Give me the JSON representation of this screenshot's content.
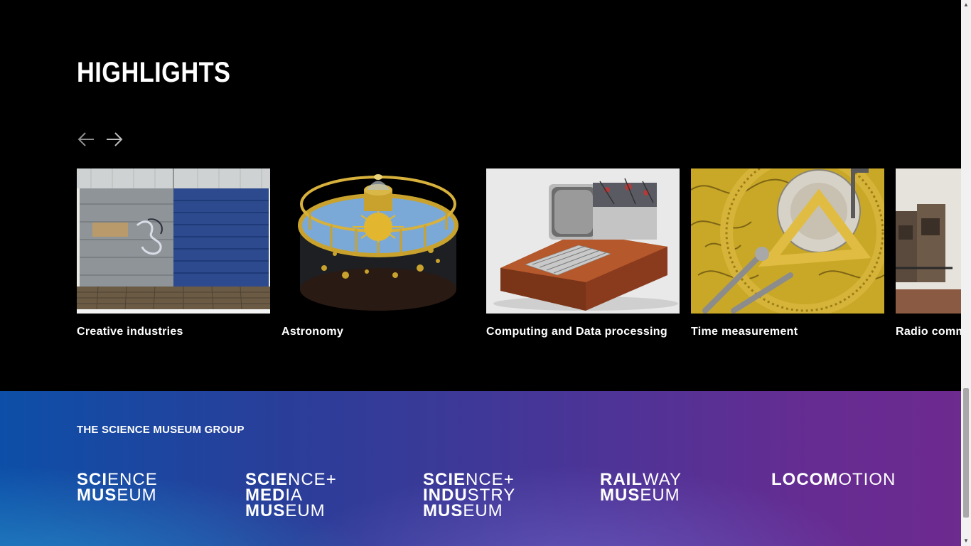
{
  "highlights": {
    "title": "HIGHLIGHTS",
    "prev_icon": "arrow-left-icon",
    "next_icon": "arrow-right-icon",
    "cards": [
      {
        "label": "Creative industries",
        "image": "painted-wooden-crate-photo"
      },
      {
        "label": "Astronomy",
        "image": "brass-orrery-photo"
      },
      {
        "label": "Computing and Data processing",
        "image": "vintage-computer-photo"
      },
      {
        "label": "Time measurement",
        "image": "engraved-clock-gears-photo"
      },
      {
        "label": "Radio comm",
        "image": "radio-equipment-photo"
      }
    ]
  },
  "footer": {
    "group_title": "THE SCIENCE MUSEUM GROUP",
    "logos": [
      {
        "name": "science-museum",
        "lines": [
          [
            "SCI",
            "ENCE"
          ],
          [
            "MUS",
            "EUM"
          ]
        ]
      },
      {
        "name": "science-media-museum",
        "lines": [
          [
            "SCIE",
            "NCE+"
          ],
          [
            "MED",
            "IA"
          ],
          [
            "MUS",
            "EUM"
          ]
        ]
      },
      {
        "name": "science-industry-museum",
        "lines": [
          [
            "SCIE",
            "NCE+"
          ],
          [
            "INDU",
            "STRY"
          ],
          [
            "MUS",
            "EUM"
          ]
        ]
      },
      {
        "name": "railway-museum",
        "lines": [
          [
            "RAIL",
            "WAY"
          ],
          [
            "MUS",
            "EUM"
          ]
        ]
      },
      {
        "name": "locomotion",
        "lines": [
          [
            "LOCOM",
            "OTION"
          ]
        ]
      }
    ],
    "gradient_colors": [
      "#0d4fa8",
      "#4a3597",
      "#6d2a8f"
    ]
  }
}
